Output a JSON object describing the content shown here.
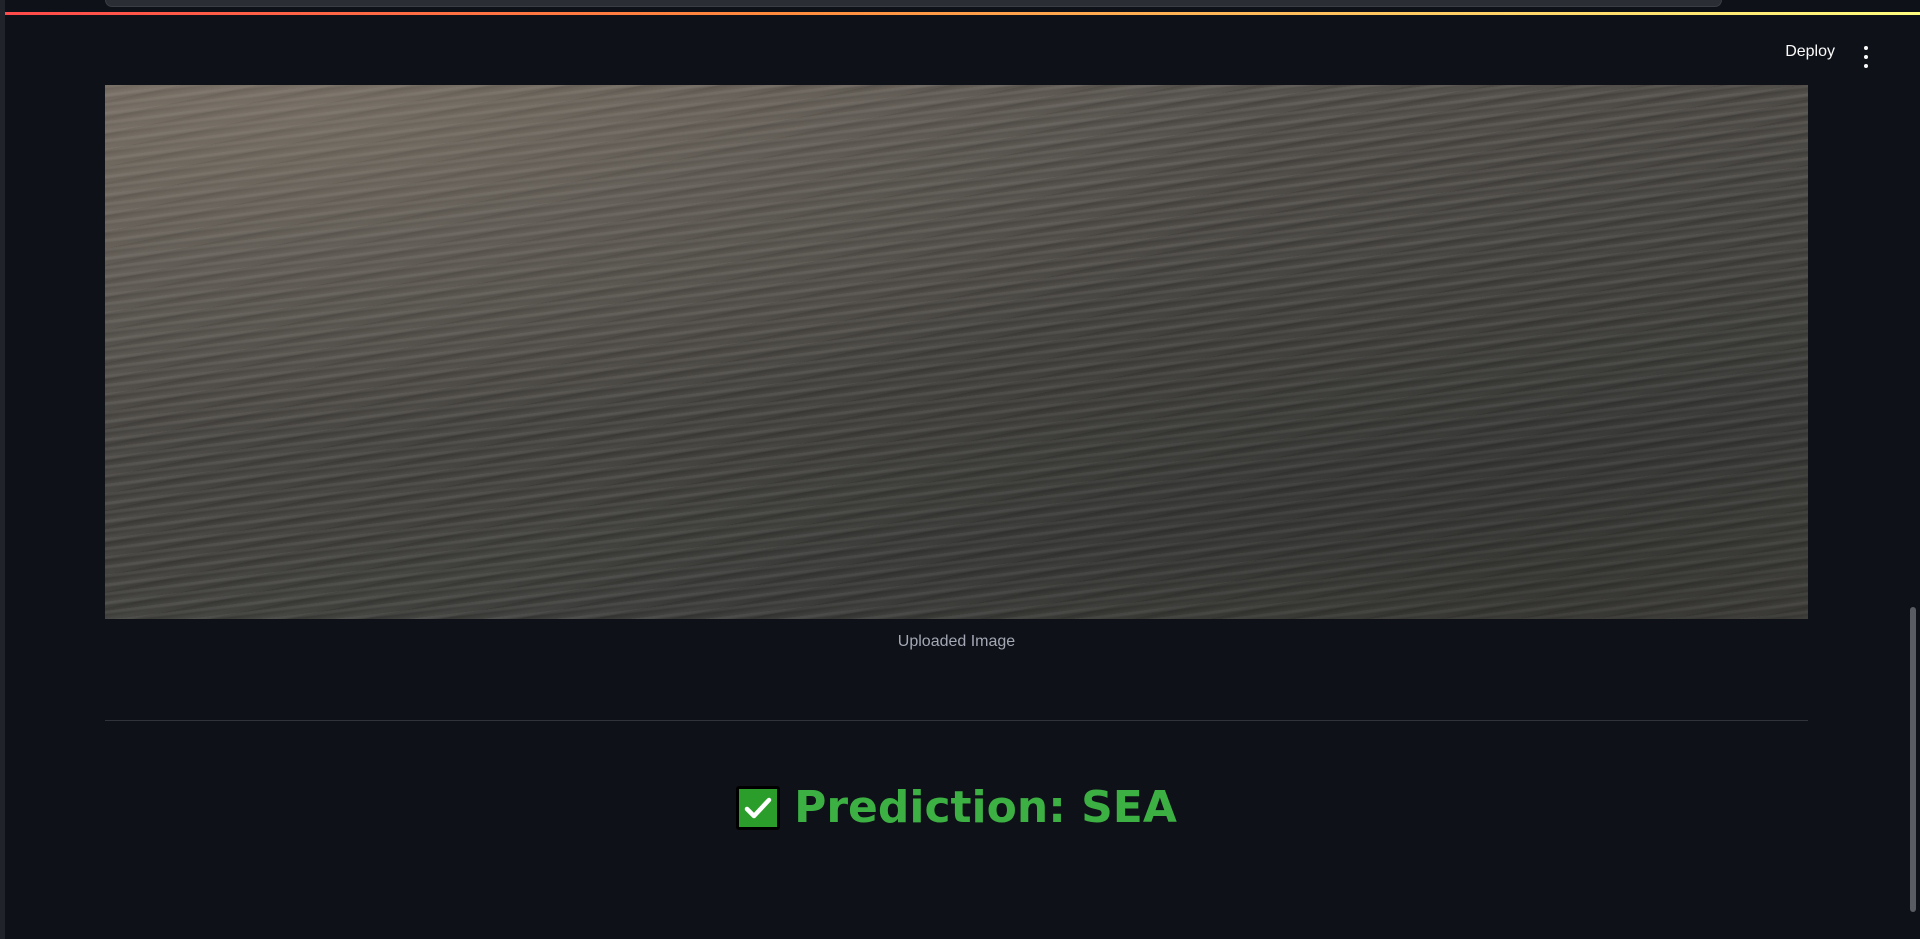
{
  "header": {
    "deploy_label": "Deploy",
    "menu_icon": "kebab-menu-icon"
  },
  "main": {
    "image": {
      "alt": "Uploaded Image",
      "caption": "Uploaded Image"
    },
    "prediction": {
      "icon": "check-mark-button-icon",
      "text": "Prediction: SEA"
    }
  },
  "colors": {
    "background": "#0e1117",
    "prediction_text": "#3cb043",
    "check_box": "#2a9d2a",
    "caption": "#a3a8b4"
  }
}
